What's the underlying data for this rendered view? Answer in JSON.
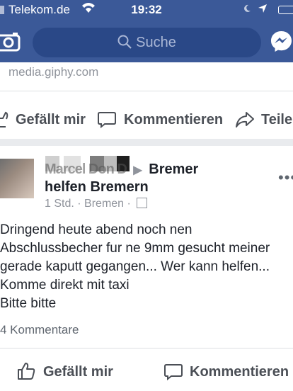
{
  "status_bar": {
    "carrier": "Telekom.de",
    "time": "19:32"
  },
  "nav": {
    "search_placeholder": "Suche"
  },
  "prev_post": {
    "link_domain": "media.giphy.com",
    "actions": {
      "like": "Gefällt mir",
      "comment": "Kommentieren",
      "share": "Teile"
    }
  },
  "post": {
    "author_name_obscured": "Marcel Don D",
    "group_line1": "Bremer",
    "group_line2": "helfen Bremern",
    "time": "1 Std.",
    "location": "Bremen",
    "text": "Dringend heute abend noch nen\nAbschlussbecher fur ne 9mm gesucht meiner\ngerade kaputt gegangen... Wer kann helfen...\nKomme direkt mit taxi\nBitte bitte",
    "comment_count": "4 Kommentare",
    "actions": {
      "like": "Gefällt mir",
      "comment": "Kommentieren"
    }
  },
  "colors": {
    "brand": "#3b5998",
    "search_bg": "#2a4887",
    "meta": "#90949c"
  },
  "icons": [
    "wifi-icon",
    "moon-icon",
    "location-icon",
    "battery-icon",
    "camera-icon",
    "search-icon",
    "messenger-icon",
    "like-icon",
    "comment-icon",
    "share-icon",
    "group-icon",
    "more-icon"
  ]
}
